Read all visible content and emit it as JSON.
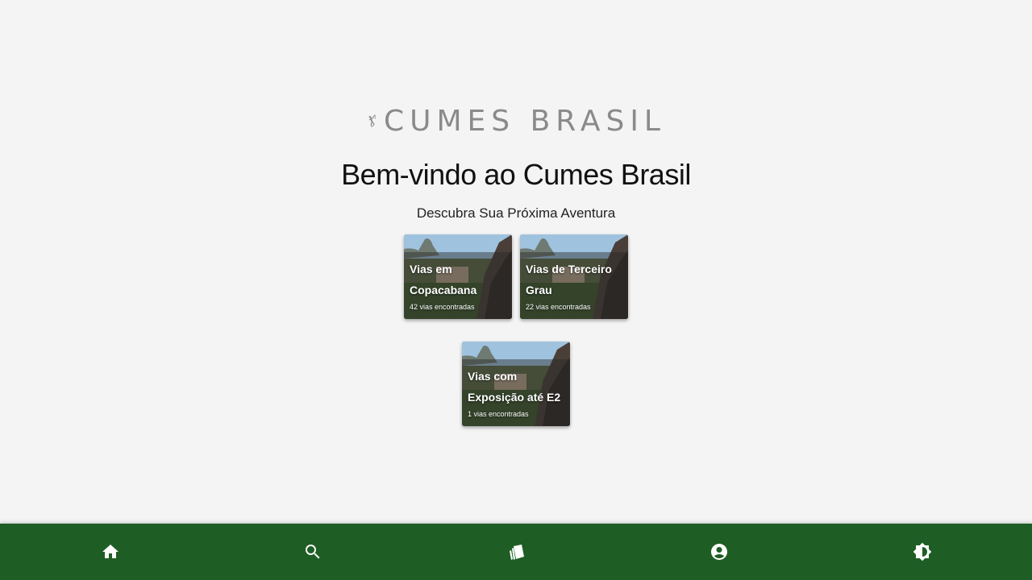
{
  "brand": {
    "logo_text": "CUMES BRASIL"
  },
  "hero": {
    "title": "Bem-vindo ao Cumes Brasil",
    "subtitle": "Descubra Sua Próxima Aventura"
  },
  "collections": [
    {
      "title": "Vias em Copacabana",
      "count": "42 vias encontradas"
    },
    {
      "title": "Vias de Terceiro Grau",
      "count": "22 vias encontradas"
    },
    {
      "title": "Vias com Exposição até E2",
      "count": "1 vias encontradas"
    }
  ],
  "bottom_nav": {
    "items": [
      {
        "icon": "home-icon"
      },
      {
        "icon": "search-icon"
      },
      {
        "icon": "collections-icon"
      },
      {
        "icon": "account-icon"
      },
      {
        "icon": "theme-toggle-icon"
      }
    ]
  },
  "colors": {
    "background": "#f4f4f4",
    "nav_background": "#1e5e24",
    "logo": "#8a8a8a"
  }
}
